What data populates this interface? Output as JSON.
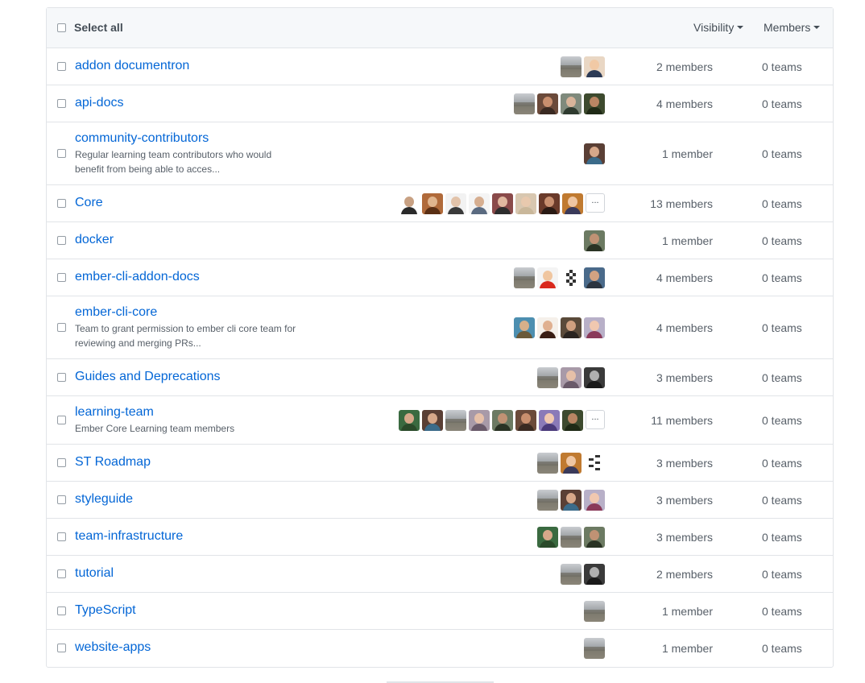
{
  "header": {
    "select_all": "Select all",
    "visibility": "Visibility",
    "members": "Members"
  },
  "teams": [
    {
      "name": "addon documentron",
      "description": "",
      "avatars": [
        "land",
        "p1"
      ],
      "more": false,
      "members": "2 members",
      "teams": "0 teams"
    },
    {
      "name": "api-docs",
      "description": "",
      "avatars": [
        "land",
        "p2",
        "p3",
        "p4"
      ],
      "more": false,
      "members": "4 members",
      "teams": "0 teams"
    },
    {
      "name": "community-contributors",
      "description": "Regular learning team contributors who would benefit from being able to acces...",
      "avatars": [
        "p5"
      ],
      "more": false,
      "members": "1 member",
      "teams": "0 teams"
    },
    {
      "name": "Core",
      "description": "",
      "avatars": [
        "p6",
        "p7",
        "p8",
        "p9",
        "p10",
        "p11",
        "p12",
        "p13"
      ],
      "more": true,
      "members": "13 members",
      "teams": "0 teams"
    },
    {
      "name": "docker",
      "description": "",
      "avatars": [
        "p14"
      ],
      "more": false,
      "members": "1 member",
      "teams": "0 teams"
    },
    {
      "name": "ember-cli-addon-docs",
      "description": "",
      "avatars": [
        "land",
        "p15",
        "ident",
        "p16"
      ],
      "more": false,
      "members": "4 members",
      "teams": "0 teams"
    },
    {
      "name": "ember-cli-core",
      "description": "Team to grant permission to ember cli core team for reviewing and merging PRs...",
      "avatars": [
        "p17",
        "p18",
        "p19",
        "p20"
      ],
      "more": false,
      "members": "4 members",
      "teams": "0 teams"
    },
    {
      "name": "Guides and Deprecations",
      "description": "",
      "avatars": [
        "land",
        "p21",
        "p22"
      ],
      "more": false,
      "members": "3 members",
      "teams": "0 teams"
    },
    {
      "name": "learning-team",
      "description": "Ember Core Learning team members",
      "avatars": [
        "p23",
        "p5",
        "land",
        "p21",
        "p14",
        "p2",
        "p24",
        "p4"
      ],
      "more": true,
      "members": "11 members",
      "teams": "0 teams"
    },
    {
      "name": "ST Roadmap",
      "description": "",
      "avatars": [
        "land",
        "p13",
        "ident2"
      ],
      "more": false,
      "members": "3 members",
      "teams": "0 teams"
    },
    {
      "name": "styleguide",
      "description": "",
      "avatars": [
        "land",
        "p5",
        "p20"
      ],
      "more": false,
      "members": "3 members",
      "teams": "0 teams"
    },
    {
      "name": "team-infrastructure",
      "description": "",
      "avatars": [
        "p23",
        "land",
        "p14"
      ],
      "more": false,
      "members": "3 members",
      "teams": "0 teams"
    },
    {
      "name": "tutorial",
      "description": "",
      "avatars": [
        "land",
        "p22"
      ],
      "more": false,
      "members": "2 members",
      "teams": "0 teams"
    },
    {
      "name": "TypeScript",
      "description": "",
      "avatars": [
        "land"
      ],
      "more": false,
      "members": "1 member",
      "teams": "0 teams"
    },
    {
      "name": "website-apps",
      "description": "",
      "avatars": [
        "land"
      ],
      "more": false,
      "members": "1 member",
      "teams": "0 teams"
    }
  ],
  "more_label": "...",
  "colors": {
    "link": "#0366d6",
    "muted": "#586069",
    "border": "#e1e4e8",
    "header_bg": "#f6f8fa"
  }
}
